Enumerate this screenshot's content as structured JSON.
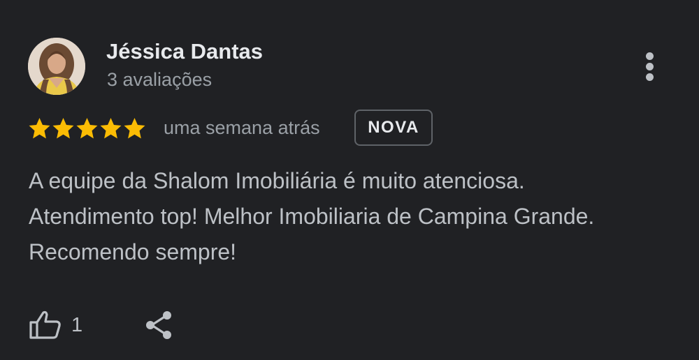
{
  "review": {
    "author_name": "Jéssica Dantas",
    "author_reviews": "3 avaliações",
    "rating": 5,
    "max_rating": 5,
    "time_ago": "uma semana atrás",
    "badge": "NOVA",
    "text_lines": [
      "A equipe da Shalom Imobiliária é muito atenciosa.",
      "Atendimento top! Melhor Imobiliaria de Campina Grande.",
      "Recomendo sempre!"
    ],
    "like_count": "1"
  },
  "icons": {
    "avatar": "profile-photo",
    "more": "more-vert-icon",
    "star": "star-icon",
    "like": "thumbs-up-icon",
    "share": "share-icon"
  },
  "colors": {
    "background": "#202124",
    "star": "#fbbc04",
    "primary_text": "#e8eaed",
    "secondary_text": "#9aa0a6",
    "body_text": "#bdc1c6",
    "badge_border": "#5f6368"
  }
}
